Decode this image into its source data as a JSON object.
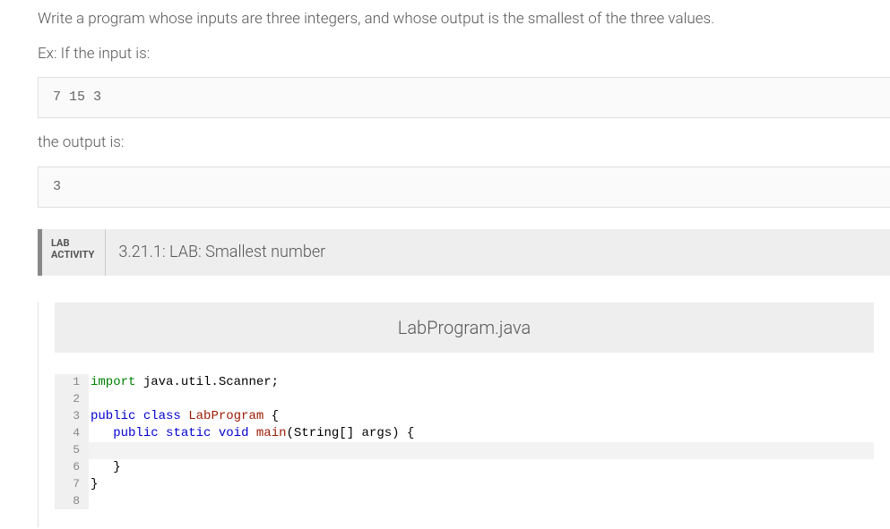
{
  "problem": {
    "description": "Write a program whose inputs are three integers, and whose output is the smallest of the three values.",
    "example_intro": "Ex: If the input is:",
    "example_input": "7 15 3",
    "output_intro": "the output is:",
    "example_output": "3"
  },
  "lab": {
    "activity_label_line1": "LAB",
    "activity_label_line2": "ACTIVITY",
    "title": "3.21.1: LAB: Smallest number",
    "filename": "LabProgram.java"
  },
  "code": {
    "lines": [
      {
        "n": "1",
        "tokens": [
          [
            "kw-import",
            "import"
          ],
          [
            "ident",
            " java.util.Scanner;"
          ]
        ]
      },
      {
        "n": "2",
        "tokens": []
      },
      {
        "n": "3",
        "tokens": [
          [
            "kw-blue",
            "public"
          ],
          [
            "ident",
            " "
          ],
          [
            "kw-blue",
            "class"
          ],
          [
            "ident",
            " "
          ],
          [
            "kw-red",
            "LabProgram"
          ],
          [
            "ident",
            " {"
          ]
        ]
      },
      {
        "n": "4",
        "tokens": [
          [
            "ident",
            "   "
          ],
          [
            "kw-blue",
            "public"
          ],
          [
            "ident",
            " "
          ],
          [
            "kw-blue",
            "static"
          ],
          [
            "ident",
            " "
          ],
          [
            "kw-blue",
            "void"
          ],
          [
            "ident",
            " "
          ],
          [
            "kw-red",
            "main"
          ],
          [
            "ident",
            "(String[] args) {"
          ]
        ]
      },
      {
        "n": "5",
        "tokens": [],
        "active": true
      },
      {
        "n": "6",
        "tokens": [
          [
            "ident",
            "   }"
          ]
        ]
      },
      {
        "n": "7",
        "tokens": [
          [
            "ident",
            "}"
          ]
        ]
      },
      {
        "n": "8",
        "tokens": []
      }
    ]
  }
}
